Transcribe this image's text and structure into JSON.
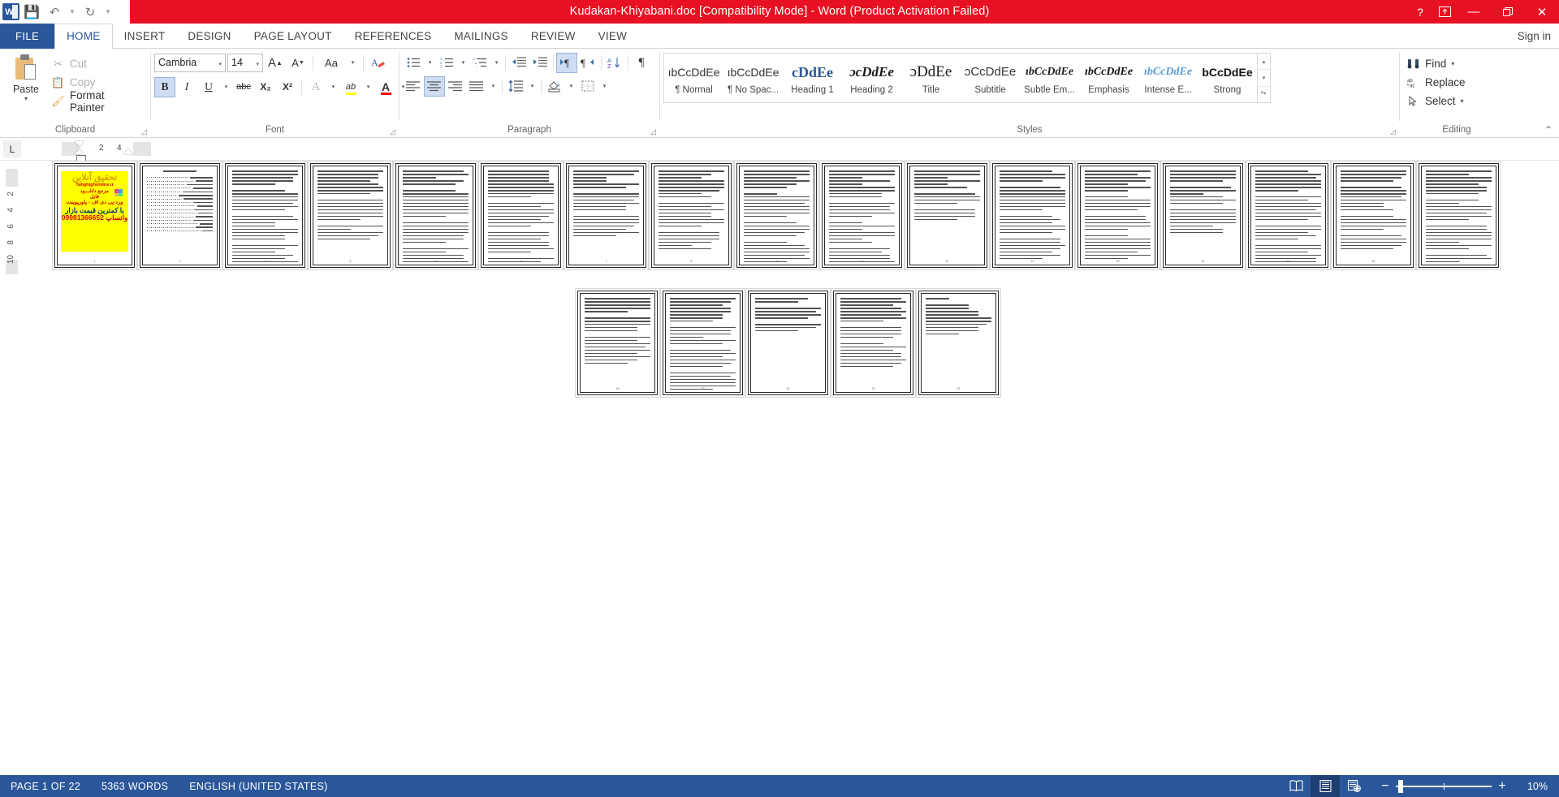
{
  "titlebar": {
    "document_title": "Kudakan-Khiyabani.doc [Compatibility Mode]  -  Word (Product Activation Failed)",
    "quick_access": [
      {
        "name": "word-logo",
        "label": "W"
      },
      {
        "name": "save-button",
        "label": "Ὃe"
      },
      {
        "name": "undo-button",
        "label": "↶"
      },
      {
        "name": "redo-button",
        "label": "↻"
      },
      {
        "name": "customize-qat-button",
        "label": "▾"
      }
    ],
    "help_label": "?",
    "ribbon_display_label": "⬆",
    "minimize_label": "—",
    "restore_label": "❐",
    "close_label": "✕"
  },
  "tabs": {
    "file": "FILE",
    "items": [
      "HOME",
      "INSERT",
      "DESIGN",
      "PAGE LAYOUT",
      "REFERENCES",
      "MAILINGS",
      "REVIEW",
      "VIEW"
    ],
    "active": "HOME",
    "sign_in": "Sign in"
  },
  "ribbon": {
    "clipboard": {
      "group_label": "Clipboard",
      "paste_label": "Paste",
      "paste_caret": "▾",
      "cut_label": "Cut",
      "copy_label": "Copy",
      "format_painter_label": "Format Painter"
    },
    "font": {
      "group_label": "Font",
      "font_name": "Cambria",
      "font_size": "14",
      "grow_font": "A",
      "shrink_font": "A",
      "change_case": "Aa",
      "clear_formatting": "✒",
      "bold": "B",
      "italic": "I",
      "underline": "U",
      "strikethrough": "abc",
      "subscript": "X₂",
      "superscript": "X²",
      "text_effects": "A",
      "highlight": "ab",
      "font_color": "A",
      "highlight_color": "#ffff00",
      "font_color_value": "#ff0000",
      "bold_active": true
    },
    "paragraph": {
      "group_label": "Paragraph",
      "bullets": "•≡",
      "numbering": "1≡",
      "multilevel": "a≡",
      "decrease_indent": "←≡",
      "increase_indent": "→≡",
      "ltr_text_direction": "▶¶",
      "rtl_text_direction": "¶◀",
      "sort": "A↓",
      "show_marks": "¶",
      "align_left": "≡",
      "align_center": "≡",
      "align_right": "≡",
      "justify": "≡",
      "line_spacing": "↕≡",
      "shading": "◳",
      "borders": "▦",
      "ltr_active": true,
      "center_active": true
    },
    "styles": {
      "group_label": "Styles",
      "items": [
        {
          "preview": "ıbCcDdEe",
          "name": "¶ Normal",
          "variant": "normal"
        },
        {
          "preview": "ıbCcDdEe",
          "name": "¶ No Spac...",
          "variant": "nospacing"
        },
        {
          "preview": "cDdEe",
          "name": "Heading 1",
          "variant": "heading1"
        },
        {
          "preview": "ɔcDdEe",
          "name": "Heading 2",
          "variant": "heading2"
        },
        {
          "preview": "ɔDdEe",
          "name": "Title",
          "variant": "title"
        },
        {
          "preview": "ɔCcDdEe",
          "name": "Subtitle",
          "variant": "subtitle"
        },
        {
          "preview": "ıbCcDdEe",
          "name": "Subtle Em...",
          "variant": "subtleem"
        },
        {
          "preview": "ıbCcDdEe",
          "name": "Emphasis",
          "variant": "emphasis"
        },
        {
          "preview": "ıbCcDdEe",
          "name": "Intense E...",
          "variant": "intenseem"
        },
        {
          "preview": "bCcDdEe",
          "name": "Strong",
          "variant": "strong"
        }
      ],
      "scroll_up": "▴",
      "scroll_down": "▾",
      "more": "▔▾"
    },
    "editing": {
      "group_label": "Editing",
      "find_label": "Find",
      "find_caret": "▾",
      "replace_label": "Replace",
      "select_label": "Select",
      "select_caret": "▾"
    },
    "collapse_label": "⌃"
  },
  "ruler": {
    "tab_selector": "L",
    "horizontal_marks": [
      "2",
      "4"
    ],
    "vertical_marks": [
      "2",
      "4",
      "6",
      "8",
      "10"
    ]
  },
  "document": {
    "total_pages": 22,
    "pages": [
      {
        "number": 1,
        "type": "cover"
      },
      {
        "number": 2,
        "type": "toc"
      },
      {
        "number": 3,
        "type": "text"
      },
      {
        "number": 4,
        "type": "text"
      },
      {
        "number": 5,
        "type": "text"
      },
      {
        "number": 6,
        "type": "text"
      },
      {
        "number": 7,
        "type": "text"
      },
      {
        "number": 8,
        "type": "text"
      },
      {
        "number": 9,
        "type": "text"
      },
      {
        "number": 10,
        "type": "text"
      },
      {
        "number": 11,
        "type": "text"
      },
      {
        "number": 12,
        "type": "text"
      },
      {
        "number": 13,
        "type": "text"
      },
      {
        "number": 14,
        "type": "text"
      },
      {
        "number": 15,
        "type": "text"
      },
      {
        "number": 16,
        "type": "text"
      },
      {
        "number": 17,
        "type": "text"
      },
      {
        "number": 18,
        "type": "text"
      },
      {
        "number": 19,
        "type": "text"
      },
      {
        "number": 20,
        "type": "short"
      },
      {
        "number": 21,
        "type": "text"
      },
      {
        "number": 22,
        "type": "references"
      }
    ],
    "cover": {
      "background_color": "#ffff00",
      "line1": "تحقیق آنلاین",
      "line2": "Tahghighonline.ir",
      "line3": "مرجع دانلـــود",
      "line4": "فایل",
      "line5": "ورد-پی دی اف - پاورپوینت",
      "line6": "با کمترین قیمت بازار",
      "line7": "09981366652 واتساپ"
    }
  },
  "statusbar": {
    "page_label": "PAGE 1 OF 22",
    "word_count": "5363 WORDS",
    "language": "ENGLISH (UNITED STATES)",
    "views": [
      {
        "name": "read-mode-view",
        "icon": "☷",
        "active": false
      },
      {
        "name": "print-layout-view",
        "icon": "☰",
        "active": true
      },
      {
        "name": "web-layout-view",
        "icon": "☸",
        "active": false
      }
    ],
    "zoom_out": "−",
    "zoom_in": "+",
    "zoom_level": "10%"
  },
  "colors": {
    "title_bar": "#e81123",
    "file_tab": "#2b579a",
    "status_bar": "#2b579a",
    "accent": "#2b579a",
    "highlight_selected": "#cfddf2"
  }
}
